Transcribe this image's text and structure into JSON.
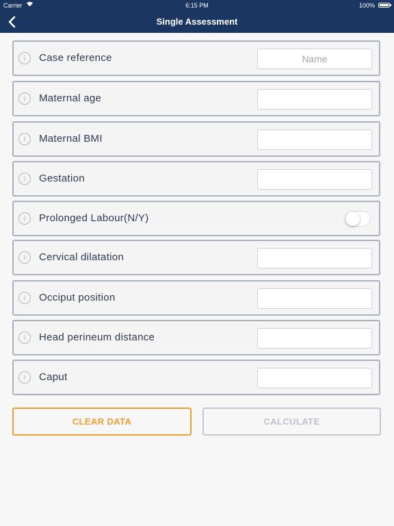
{
  "status_bar": {
    "carrier": "Carrier",
    "time": "6:15 PM",
    "battery": "100%"
  },
  "nav": {
    "title": "Single Assessment"
  },
  "fields": [
    {
      "label": "Case reference",
      "placeholder": "Name",
      "value": ""
    },
    {
      "label": "Maternal age",
      "placeholder": "",
      "value": ""
    },
    {
      "label": "Maternal BMI",
      "placeholder": "",
      "value": ""
    },
    {
      "label": "Gestation",
      "placeholder": "",
      "value": ""
    },
    {
      "label": "Prolonged Labour(N/Y)",
      "toggle": false
    },
    {
      "label": "Cervical dilatation",
      "placeholder": "",
      "value": ""
    },
    {
      "label": "Occiput position",
      "placeholder": "",
      "value": ""
    },
    {
      "label": "Head perineum distance",
      "placeholder": "",
      "value": ""
    },
    {
      "label": "Caput",
      "placeholder": "",
      "value": ""
    }
  ],
  "buttons": {
    "clear": "CLEAR DATA",
    "calculate": "CALCULATE"
  },
  "colors": {
    "nav_bg": "#1b3660",
    "accent_orange": "#f39c2f",
    "row_border": "#a9b1c0",
    "disabled": "#c3c8d0"
  }
}
